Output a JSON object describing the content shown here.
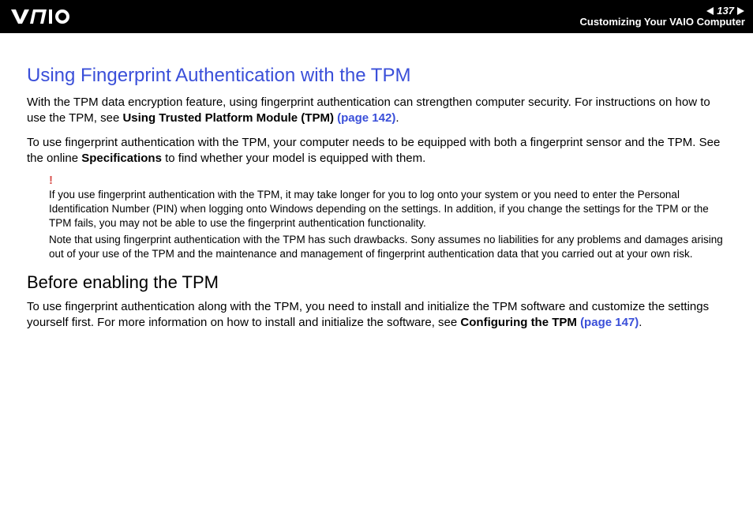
{
  "header": {
    "page_number": "137",
    "breadcrumb": "Customizing Your VAIO Computer"
  },
  "main": {
    "title": "Using Fingerprint Authentication with the TPM",
    "p1_a": "With the TPM data encryption feature, using fingerprint authentication can strengthen computer security. For instructions on how to use the TPM, see ",
    "p1_b": "Using Trusted Platform Module (TPM) ",
    "p1_link": "(page 142)",
    "p1_c": ".",
    "p2_a": "To use fingerprint authentication with the TPM, your computer needs to be equipped with both a fingerprint sensor and the TPM. See the online ",
    "p2_b": "Specifications",
    "p2_c": " to find whether your model is equipped with them.",
    "note_mark": "!",
    "note1": "If you use fingerprint authentication with the TPM, it may take longer for you to log onto your system or you need to enter the Personal Identification Number (PIN) when logging onto Windows depending on the settings. In addition, if you change the settings for the TPM or the TPM fails, you may not be able to use the fingerprint authentication functionality.",
    "note2": "Note that using fingerprint authentication with the TPM has such drawbacks. Sony assumes no liabilities for any problems and damages arising out of your use of the TPM and the maintenance and management of fingerprint authentication data that you carried out at your own risk.",
    "subtitle": "Before enabling the TPM",
    "p3_a": "To use fingerprint authentication along with the TPM, you need to install and initialize the TPM software and customize the settings yourself first. For more information on how to install and initialize the software, see ",
    "p3_b": "Configuring the TPM ",
    "p3_link": "(page 147)",
    "p3_c": "."
  }
}
